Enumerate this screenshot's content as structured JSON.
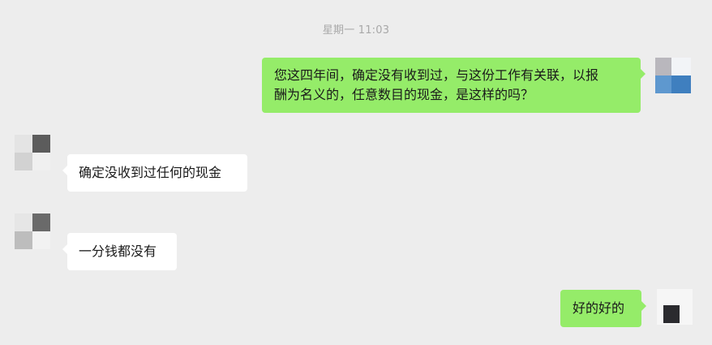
{
  "chat": {
    "timestamp": "星期一 11:03",
    "messages": [
      {
        "direction": "outgoing",
        "lines": [
          "您这四年间，确定没有收到过，与这份工作有关联，以报",
          "酬为名义的，任意数目的现金，是这样的吗？"
        ]
      },
      {
        "direction": "incoming",
        "lines": [
          "确定没收到过任何的现金"
        ]
      },
      {
        "direction": "incoming",
        "lines": [
          "一分钱都没有"
        ]
      },
      {
        "direction": "outgoing",
        "lines": [
          "好的好的"
        ]
      }
    ]
  },
  "colors": {
    "background": "#ededed",
    "outgoing_bubble": "#95ec69",
    "incoming_bubble": "#ffffff",
    "timestamp_text": "#a8a8a8",
    "message_text": "#1a1a1a"
  }
}
